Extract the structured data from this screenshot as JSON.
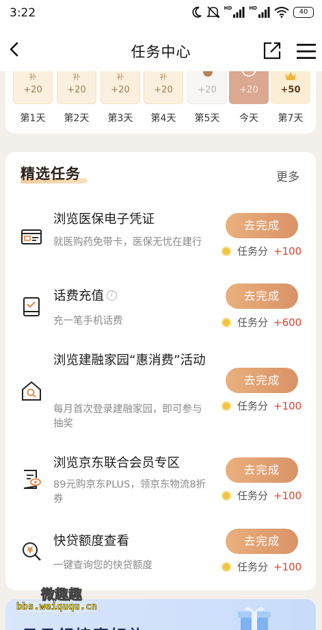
{
  "status_bar": {
    "time": "3:22",
    "network_a": "HD",
    "network_b": "HD",
    "battery": "40"
  },
  "nav": {
    "title": "任务中心"
  },
  "checkin": {
    "days": [
      {
        "mark": "补",
        "points": "+20",
        "label": "第1天"
      },
      {
        "mark": "补",
        "points": "+20",
        "label": "第2天"
      },
      {
        "mark": "补",
        "points": "+20",
        "label": "第3天"
      },
      {
        "mark": "补",
        "points": "+20",
        "label": "第4天"
      },
      {
        "mark": "",
        "points": "+20",
        "label": "第5天"
      },
      {
        "mark": "",
        "points": "+20",
        "label": "今天"
      },
      {
        "mark": "",
        "points": "+50",
        "label": "第7天"
      }
    ]
  },
  "tasks_section": {
    "title": "精选任务",
    "more": "更多",
    "reward_label": "任务分",
    "tasks": [
      {
        "title": "浏览医保电子凭证",
        "desc": "就医购药免带卡，医保无忧在建行",
        "button": "去完成",
        "points": "+100"
      },
      {
        "title": "话费充值",
        "desc": "充一笔手机话费",
        "button": "去完成",
        "points": "+600"
      },
      {
        "title": "浏览建融家园“惠消费”活动",
        "desc": "每月首次登录建融家园，即可参与抽奖",
        "button": "去完成",
        "points": "+100"
      },
      {
        "title": "浏览京东联合会员专区",
        "desc": "89元购京东PLUS，领京东物流8折券",
        "button": "去完成",
        "points": "+100"
      },
      {
        "title": "快贷额度查看",
        "desc": "一键查询您的快贷额度",
        "button": "去完成",
        "points": "+100"
      }
    ]
  },
  "banner": {
    "text": "日日领惊喜好礼"
  },
  "watermark": {
    "cn": "微趣趣",
    "url": "bbs.weiququ.cn"
  },
  "colors": {
    "accent": "#d99267",
    "reward": "#d5452e",
    "coin": "#f3c33b"
  }
}
